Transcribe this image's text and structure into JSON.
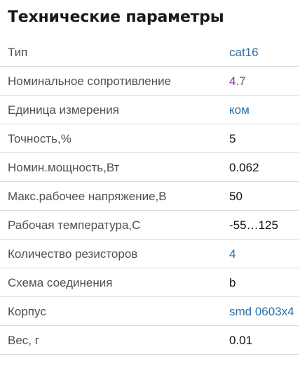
{
  "title": "Технические параметры",
  "colors": {
    "link": "#2b6fa8",
    "visited_link": "#8e3a9d",
    "text": "#111111",
    "label": "#505050",
    "divider": "#dcdcdc"
  },
  "params": [
    {
      "label": "Тип",
      "value": "cat16",
      "style": "link"
    },
    {
      "label": "Номинальное сопротивление",
      "value": "4.7",
      "style": "visited"
    },
    {
      "label": "Единица измерения",
      "value": "ком",
      "style": "link"
    },
    {
      "label": "Точность,%",
      "value": "5",
      "style": "plain"
    },
    {
      "label": "Номин.мощность,Вт",
      "value": "0.062",
      "style": "plain"
    },
    {
      "label": "Макс.рабочее напряжение,В",
      "value": "50",
      "style": "plain"
    },
    {
      "label": "Рабочая температура,С",
      "value": "-55…125",
      "style": "plain"
    },
    {
      "label": "Количество резисторов",
      "value": "4",
      "style": "link"
    },
    {
      "label": "Схема соединения",
      "value": "b",
      "style": "plain"
    },
    {
      "label": "Корпус",
      "value": "smd 0603x4",
      "style": "link"
    },
    {
      "label": "Вес, г",
      "value": "0.01",
      "style": "plain"
    }
  ]
}
